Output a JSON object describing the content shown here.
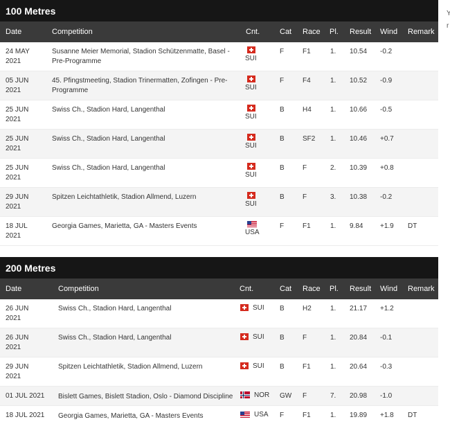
{
  "gutter": {
    "chars": [
      "Y",
      "r"
    ]
  },
  "sections": [
    {
      "title": "100 Metres",
      "headers": {
        "date": "Date",
        "competition": "Competition",
        "cnt": "Cnt.",
        "cat": "Cat",
        "race": "Race",
        "pl": "Pl.",
        "result": "Result",
        "wind": "Wind",
        "remark": "Remark"
      },
      "rows": [
        {
          "date": "24 MAY 2021",
          "competition": "Susanne Meier Memorial, Stadion Schützenmatte, Basel - Pre-Programme",
          "country": "SUI",
          "flag": "sui",
          "cat": "F",
          "race": "F1",
          "pl": "1.",
          "result": "10.54",
          "wind": "-0.2",
          "remark": ""
        },
        {
          "date": "05 JUN 2021",
          "competition": "45. Pfingstmeeting, Stadion Trinermatten, Zofingen - Pre-Programme",
          "country": "SUI",
          "flag": "sui",
          "cat": "F",
          "race": "F4",
          "pl": "1.",
          "result": "10.52",
          "wind": "-0.9",
          "remark": ""
        },
        {
          "date": "25 JUN 2021",
          "competition": "Swiss Ch., Stadion Hard, Langenthal",
          "country": "SUI",
          "flag": "sui",
          "cat": "B",
          "race": "H4",
          "pl": "1.",
          "result": "10.66",
          "wind": "-0.5",
          "remark": ""
        },
        {
          "date": "25 JUN 2021",
          "competition": "Swiss Ch., Stadion Hard, Langenthal",
          "country": "SUI",
          "flag": "sui",
          "cat": "B",
          "race": "SF2",
          "pl": "1.",
          "result": "10.46",
          "wind": "+0.7",
          "remark": ""
        },
        {
          "date": "25 JUN 2021",
          "competition": "Swiss Ch., Stadion Hard, Langenthal",
          "country": "SUI",
          "flag": "sui",
          "cat": "B",
          "race": "F",
          "pl": "2.",
          "result": "10.39",
          "wind": "+0.8",
          "remark": ""
        },
        {
          "date": "29 JUN 2021",
          "competition": "Spitzen Leichtathletik, Stadion Allmend, Luzern",
          "country": "SUI",
          "flag": "sui",
          "cat": "B",
          "race": "F",
          "pl": "3.",
          "result": "10.38",
          "wind": "-0.2",
          "remark": ""
        },
        {
          "date": "18 JUL 2021",
          "competition": "Georgia Games, Marietta, GA - Masters Events",
          "country": "USA",
          "flag": "usa",
          "cat": "F",
          "race": "F1",
          "pl": "1.",
          "result": "9.84",
          "wind": "+1.9",
          "remark": "DT"
        }
      ]
    },
    {
      "title": "200 Metres",
      "headers": {
        "date": "Date",
        "competition": "Competition",
        "cnt": "Cnt.",
        "cat": "Cat",
        "race": "Race",
        "pl": "Pl.",
        "result": "Result",
        "wind": "Wind",
        "remark": "Remark"
      },
      "rows": [
        {
          "date": "26 JUN 2021",
          "competition": "Swiss Ch., Stadion Hard, Langenthal",
          "country": "SUI",
          "flag": "sui",
          "cat": "B",
          "race": "H2",
          "pl": "1.",
          "result": "21.17",
          "wind": "+1.2",
          "remark": ""
        },
        {
          "date": "26 JUN 2021",
          "competition": "Swiss Ch., Stadion Hard, Langenthal",
          "country": "SUI",
          "flag": "sui",
          "cat": "B",
          "race": "F",
          "pl": "1.",
          "result": "20.84",
          "wind": "-0.1",
          "remark": ""
        },
        {
          "date": "29 JUN 2021",
          "competition": "Spitzen Leichtathletik, Stadion Allmend, Luzern",
          "country": "SUI",
          "flag": "sui",
          "cat": "B",
          "race": "F1",
          "pl": "1.",
          "result": "20.64",
          "wind": "-0.3",
          "remark": ""
        },
        {
          "date": "01 JUL 2021",
          "competition": "Bislett Games, Bislett Stadion, Oslo - Diamond Discipline",
          "country": "NOR",
          "flag": "nor",
          "cat": "GW",
          "race": "F",
          "pl": "7.",
          "result": "20.98",
          "wind": "-1.0",
          "remark": ""
        },
        {
          "date": "18 JUL 2021",
          "competition": "Georgia Games, Marietta, GA - Masters Events",
          "country": "USA",
          "flag": "usa",
          "cat": "F",
          "race": "F1",
          "pl": "1.",
          "result": "19.89",
          "wind": "+1.8",
          "remark": "DT"
        }
      ]
    }
  ]
}
